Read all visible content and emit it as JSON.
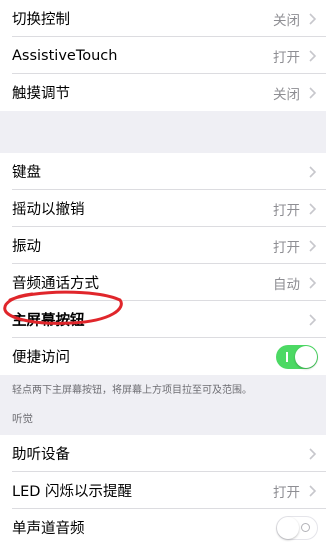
{
  "groups": [
    {
      "rows": [
        {
          "label": "切换控制",
          "value": "关闭",
          "chevron": true
        },
        {
          "label": "AssistiveTouch",
          "value": "打开",
          "chevron": true
        },
        {
          "label": "触摸调节",
          "value": "关闭",
          "chevron": true
        }
      ]
    },
    {
      "rows": [
        {
          "label": "键盘",
          "value": "",
          "chevron": true
        },
        {
          "label": "摇动以撤销",
          "value": "打开",
          "chevron": true
        },
        {
          "label": "振动",
          "value": "打开",
          "chevron": true
        },
        {
          "label": "音频通话方式",
          "value": "自动",
          "chevron": true
        },
        {
          "label": "主屏幕按钮",
          "value": "",
          "chevron": true
        },
        {
          "label": "便捷访问",
          "toggle": "on"
        }
      ],
      "footnote": "轻点两下主屏幕按钮，将屏幕上方项目拉至可及范围。"
    },
    {
      "header": "听觉",
      "rows": [
        {
          "label": "助听设备",
          "value": "",
          "chevron": true
        },
        {
          "label": "LED 闪烁以示提醒",
          "value": "打开",
          "chevron": true
        },
        {
          "label": "单声道音频",
          "toggle": "off"
        }
      ]
    }
  ],
  "colors": {
    "toggle_on": "#4cd964",
    "annotation_circle": "#e0262b",
    "secondary_text": "#8e8e93"
  },
  "icons": {
    "disclosure": "chevron-right-icon"
  }
}
